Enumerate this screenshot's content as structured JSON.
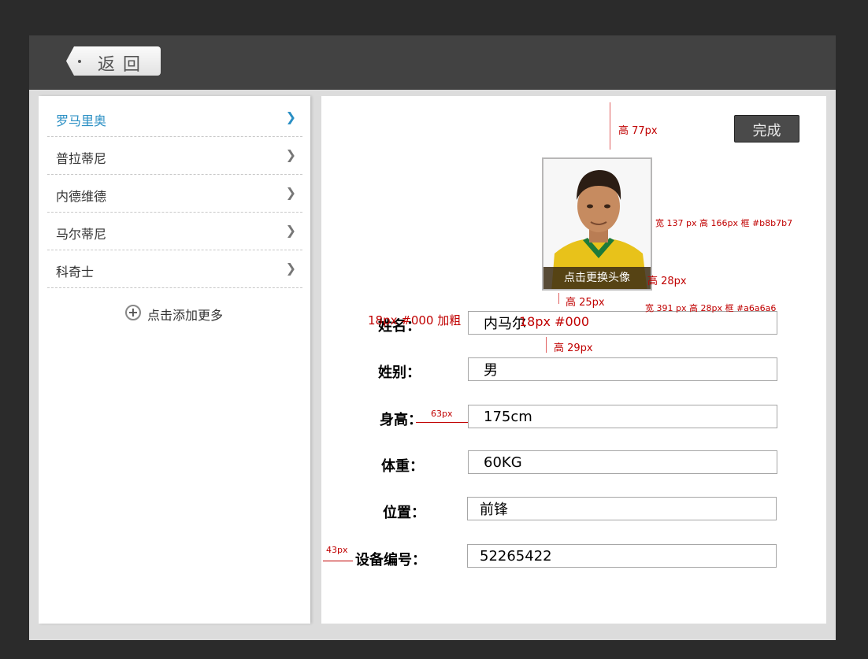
{
  "topbar": {
    "back_label": "返回"
  },
  "sidebar": {
    "items": [
      {
        "label": "罗马里奥",
        "active": true
      },
      {
        "label": "普拉蒂尼",
        "active": false
      },
      {
        "label": "内德维德",
        "active": false
      },
      {
        "label": "马尔蒂尼",
        "active": false
      },
      {
        "label": "科奇士",
        "active": false
      }
    ],
    "chevron": "❯",
    "add_more_label": "点击添加更多",
    "add_more_icon": "plus-circle-icon"
  },
  "main": {
    "done_label": "完成",
    "avatar": {
      "caption": "点击更换头像",
      "border_color": "#b8b7b7"
    },
    "form": [
      {
        "label": "姓名：",
        "value": "内马尔"
      },
      {
        "label": "姓别：",
        "value": "男"
      },
      {
        "label": "身高：",
        "value": "175cm"
      },
      {
        "label": "体重：",
        "value": "60KG"
      },
      {
        "label": "位置：",
        "value": "前锋"
      },
      {
        "label": "设备编号：",
        "value": "52265422"
      }
    ]
  },
  "annotations": {
    "top_gap": "高 77px",
    "avatar_size": "宽 137 px 高 166px 框 #b8b7b7",
    "caption_height": "高 28px",
    "gap_avatar_form": "高 25px",
    "input_size": "宽 391 px 高 28px 框 #a6a6a6",
    "label_style": "18px #000 加粗",
    "input_style": "18px #000",
    "row_gap": "高 29px",
    "label_input_gap": "63px",
    "left_gap": "43px"
  },
  "colors": {
    "active_item": "#2a8fc4",
    "annotation": "#c00000",
    "input_border": "#a6a6a6"
  }
}
